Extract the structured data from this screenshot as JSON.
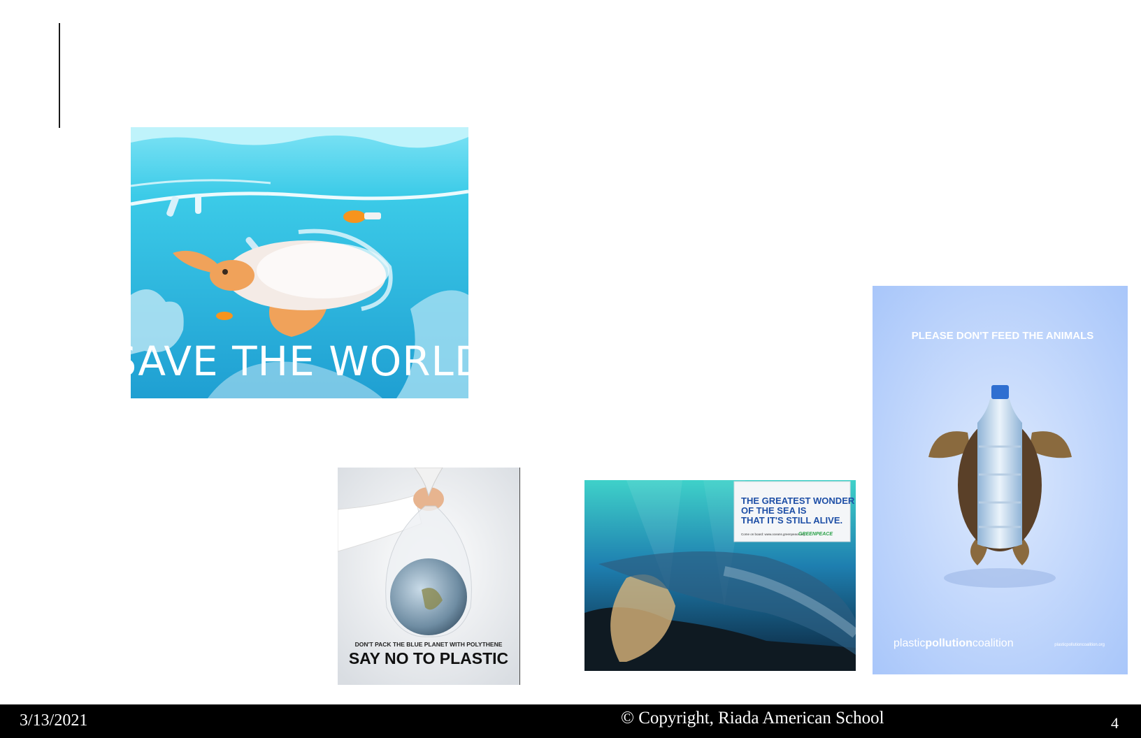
{
  "slide": {
    "pictures": {
      "turtle_ocean": {
        "caption": "SAVE THE WORLD"
      },
      "plastic_bag_globe": {
        "line1": "DON'T PACK THE BLUE PLANET WITH POLYTHENE",
        "line2": "SAY NO TO PLASTIC"
      },
      "greenpeace_sea": {
        "line1": "THE GREATEST WONDER",
        "line2": "OF THE SEA IS",
        "line3": "THAT IT'S STILL ALIVE.",
        "small": "Come on board: www.oceans.greenpeace.org",
        "brand": "GREENPEACE"
      },
      "bottle_turtle": {
        "headline": "PLEASE DON'T FEED THE ANIMALS",
        "brand_part1": "plastic",
        "brand_part2": "pollution",
        "brand_part3": "coalition",
        "url": "plasticpollutioncoalition.org"
      }
    }
  },
  "footer": {
    "date": "3/13/2021",
    "copyright": "© Copyright, Riada American School",
    "page_number": "4"
  },
  "colors": {
    "footer_bg": "#000000",
    "footer_text": "#ffffff",
    "ocean": "#2fb8de",
    "poster_blue": "#a9c8fb"
  }
}
